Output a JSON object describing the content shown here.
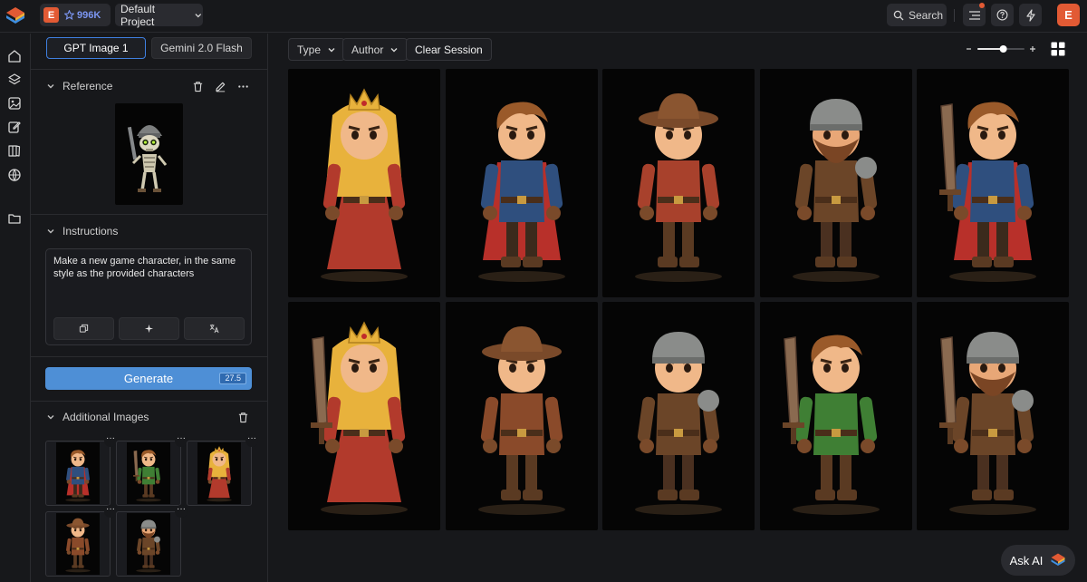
{
  "topbar": {
    "credits": {
      "badge": "E",
      "value": "996K"
    },
    "project": "Default Project",
    "search": "Search",
    "avatar": "E"
  },
  "panel": {
    "models": [
      "GPT Image 1",
      "Gemini 2.0 Flash"
    ],
    "reference": {
      "title": "Reference"
    },
    "instructions": {
      "title": "Instructions",
      "text": "Make a new game character, in the same style as the provided characters"
    },
    "generate": {
      "label": "Generate",
      "cost": "27.5"
    },
    "additional": {
      "title": "Additional Images",
      "count": 5
    }
  },
  "main": {
    "filters": [
      "Type",
      "Author"
    ],
    "clear_session": "Clear Session",
    "zoom_level": 0.55,
    "tiles": [
      {
        "character": "princess"
      },
      {
        "character": "hero-caped"
      },
      {
        "character": "ranger-hat"
      },
      {
        "character": "dwarf-helmet"
      },
      {
        "character": "hero-sword-caped"
      },
      {
        "character": "princess-sword"
      },
      {
        "character": "ranger-hat-leather"
      },
      {
        "character": "warrior-helmet"
      },
      {
        "character": "hero-green-sword"
      },
      {
        "character": "dwarf-sword"
      }
    ]
  },
  "ask_ai": "Ask AI",
  "colors": {
    "accent": "#4e8fd6",
    "brand": "#e25a34",
    "background": "#17181b",
    "tile": "#050505"
  }
}
